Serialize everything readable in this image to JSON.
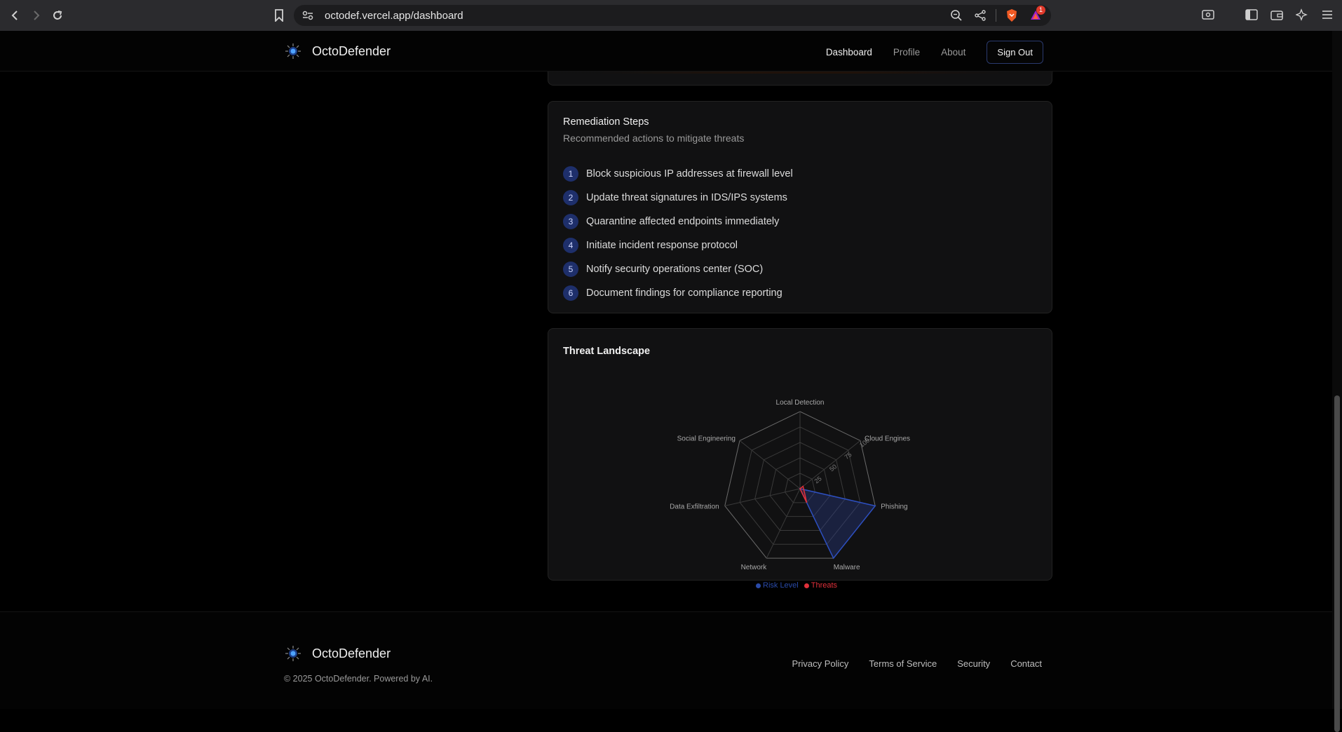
{
  "browser": {
    "url": "octodef.vercel.app/dashboard",
    "notification_count": "1"
  },
  "header": {
    "brand": "OctoDefender",
    "nav": {
      "dashboard": "Dashboard",
      "profile": "Profile",
      "about": "About"
    },
    "signout_label": "Sign Out"
  },
  "remediation": {
    "title": "Remediation Steps",
    "subtitle": "Recommended actions to mitigate threats",
    "steps": [
      {
        "num": "1",
        "text": "Block suspicious IP addresses at firewall level"
      },
      {
        "num": "2",
        "text": "Update threat signatures in IDS/IPS systems"
      },
      {
        "num": "3",
        "text": "Quarantine affected endpoints immediately"
      },
      {
        "num": "4",
        "text": "Initiate incident response protocol"
      },
      {
        "num": "5",
        "text": "Notify security operations center (SOC)"
      },
      {
        "num": "6",
        "text": "Document findings for compliance reporting"
      }
    ]
  },
  "threat_landscape": {
    "title": "Threat Landscape"
  },
  "chart_data": {
    "type": "radar",
    "categories": [
      "Local Detection",
      "Cloud Engines",
      "Phishing",
      "Malware",
      "Network",
      "Data Exfiltration",
      "Social Engineering"
    ],
    "rlim": [
      0,
      100
    ],
    "ticks": [
      "25",
      "50",
      "75",
      "100"
    ],
    "series": [
      {
        "name": "Risk Level",
        "color": "#2a3f96",
        "values": [
          0,
          0,
          100,
          100,
          0,
          0,
          0
        ]
      },
      {
        "name": "Threats",
        "color": "#e0303a",
        "values": [
          0,
          5,
          5,
          20,
          0,
          0,
          0
        ]
      }
    ],
    "legend": "bottom"
  },
  "footer": {
    "brand": "OctoDefender",
    "copyright": "© 2025 OctoDefender. Powered by AI.",
    "links": {
      "privacy": "Privacy Policy",
      "terms": "Terms of Service",
      "security": "Security",
      "contact": "Contact"
    }
  }
}
